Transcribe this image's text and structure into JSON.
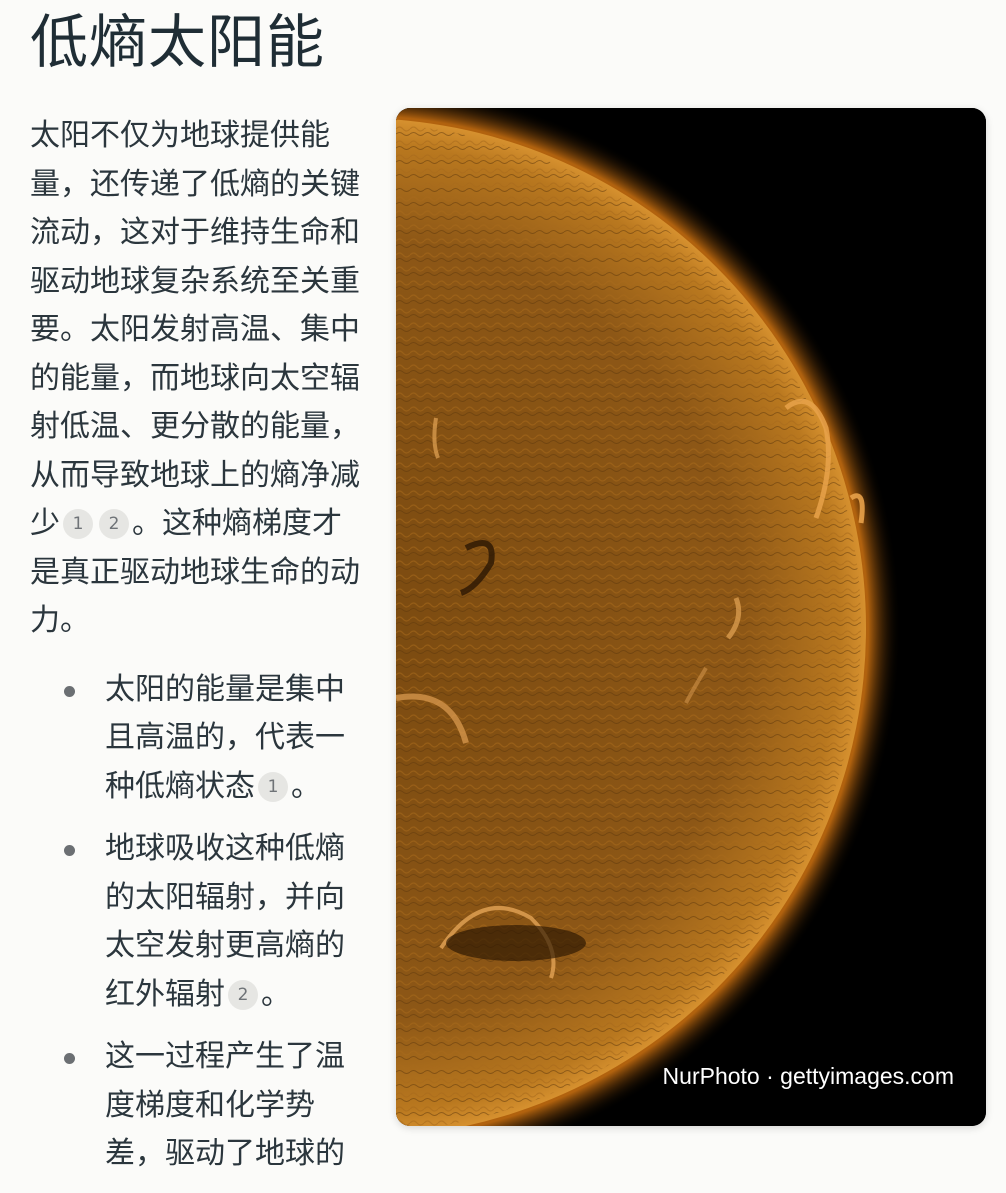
{
  "heading": "低熵太阳能",
  "intro": {
    "text": "太阳不仅为地球提供能量，还传递了低熵的关键流动，这对于维持生命和驱动地球复杂系统至关重要。太阳发射高温、集中的能量，而地球向太空辐射低温、更分散的能量，从而导致地球上的熵净减少",
    "cites": [
      "1",
      "2"
    ],
    "tail": "。这种熵梯度才是真正驱动地球生命的动力。"
  },
  "bullets": [
    {
      "text": "太阳的能量是集中且高温的，代表一种低熵状态",
      "cite": "1",
      "end": "。"
    },
    {
      "text": "地球吸收这种低熵的太阳辐射，并向太空发射更高熵的红外辐射",
      "cite": "2",
      "end": "。"
    },
    {
      "text": "这一过程产生了温度梯度和化学势差，驱动了地球的",
      "cite": "",
      "end": ""
    }
  ],
  "image": {
    "credit": "NurPhoto · gettyimages.com",
    "colors": {
      "sun_core": "#8a5414",
      "sun_limb": "#d08a2a",
      "space": "#000000"
    }
  }
}
